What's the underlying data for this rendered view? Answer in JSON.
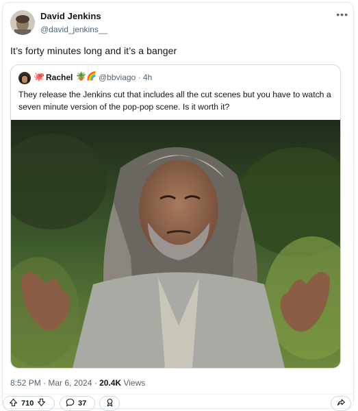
{
  "author": {
    "name": "David Jenkins",
    "handle": "@david_jenkins__"
  },
  "tweet": {
    "text": "It’s forty minutes long and it’s a banger"
  },
  "quote": {
    "name": "Rachel",
    "octopus_emoji": "🐙",
    "plant_emoji": "🪴",
    "rainbow_emoji": "🌈",
    "handle_time": "@bbviago · 4h",
    "text": "They release the Jenkins cut that includes all the cut scenes but you have to watch a seven minute version of the pop-pop scene. Is it worth it?"
  },
  "meta": {
    "time_date": "8:52 PM · Mar 6, 2024 · ",
    "views_count": "20.4K",
    "views_label": "Views"
  },
  "actions": {
    "upvotes": "710",
    "replies": "37"
  },
  "icons": {
    "more": "more-options-icon",
    "upvote": "upvote-arrow-icon",
    "downvote": "downvote-arrow-icon",
    "reply": "reply-bubble-icon",
    "award": "award-icon",
    "share": "share-icon"
  }
}
